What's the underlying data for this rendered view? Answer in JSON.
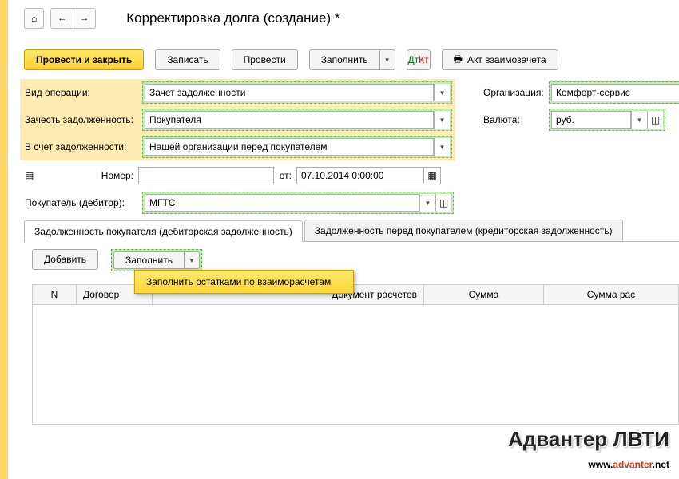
{
  "header": {
    "title": "Корректировка долга (создание) *"
  },
  "toolbar": {
    "post_close": "Провести и закрыть",
    "save": "Записать",
    "post": "Провести",
    "fill": "Заполнить",
    "act": "Акт взаимозачета"
  },
  "form": {
    "op_type_label": "Вид операции:",
    "op_type_value": "Зачет задолженности",
    "offset_label": "Зачесть задолженность:",
    "offset_value": "Покупателя",
    "against_label": "В счет задолженности:",
    "against_value": "Нашей организации перед покупателем",
    "number_label": "Номер:",
    "number_value": "",
    "from_label": "от:",
    "date_value": "07.10.2014  0:00:00",
    "buyer_label": "Покупатель (дебитор):",
    "buyer_value": "МГТС",
    "org_label": "Организация:",
    "org_value": "Комфорт-сервис",
    "currency_label": "Валюта:",
    "currency_value": "руб."
  },
  "tabs": {
    "tab1": "Задолженность покупателя (дебиторская задолженность)",
    "tab2": "Задолженность перед покупателем (кредиторская задолженность)"
  },
  "tab_toolbar": {
    "add": "Добавить",
    "fill": "Заполнить"
  },
  "popup": {
    "fill_balances": "Заполнить остатками по взаиморасчетам"
  },
  "table": {
    "col_n": "N",
    "col_contract": "Договор",
    "col_doc": "Документ расчетов",
    "col_sum": "Сумма",
    "col_sum_calc": "Сумма рас"
  },
  "watermark": {
    "line1": "Адвантер ЛВТИ",
    "www": "www.",
    "adv": "advanter",
    "net": ".net"
  }
}
